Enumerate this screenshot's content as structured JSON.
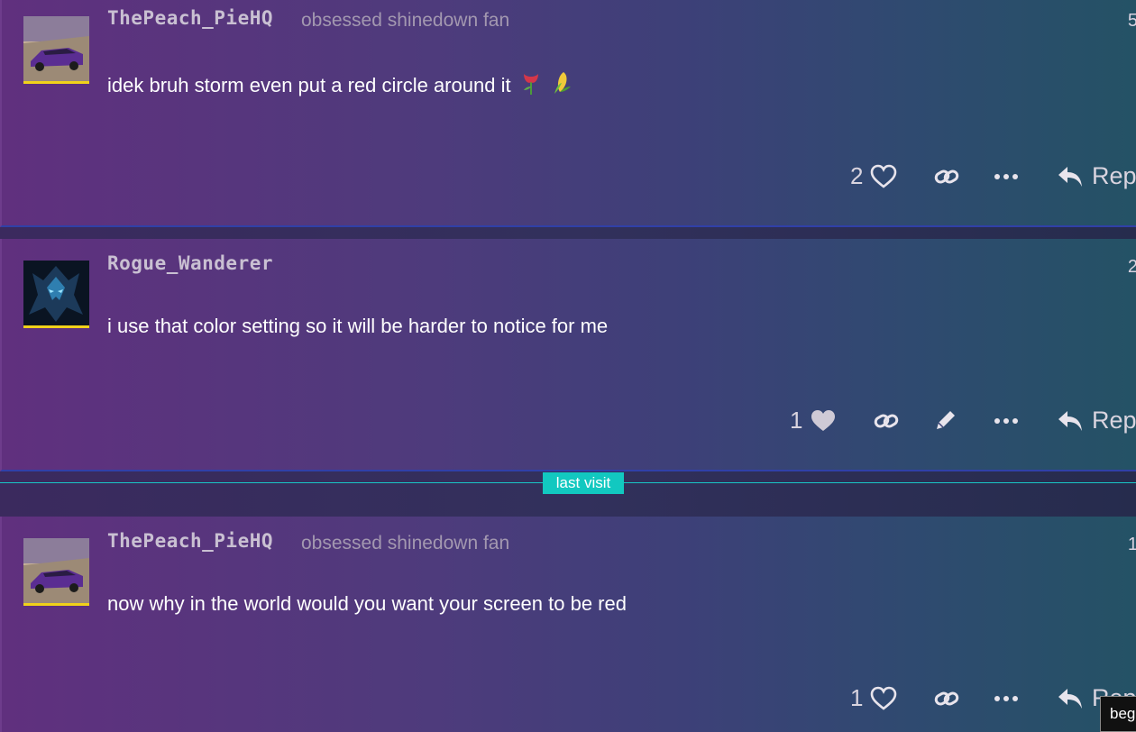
{
  "posts": [
    {
      "username": "ThePeach_PieHQ",
      "user_title": "obsessed shinedown fan",
      "post_number": "5",
      "content": "idek bruh storm even put a red circle around it",
      "emojis": [
        "wilted-flower-emoji",
        "corn-emoji"
      ],
      "likes": "2",
      "liked": false,
      "avatar": "purple-muscle-car-avatar",
      "actions": [
        "like",
        "copy-link",
        "more",
        "reply"
      ],
      "reply_label": "Reply"
    },
    {
      "username": "Rogue_Wanderer",
      "user_title": "",
      "post_number": "2",
      "content": "i use that color setting so it will be harder to notice for me",
      "likes": "1",
      "liked": true,
      "avatar": "dark-blue-knight-avatar",
      "actions": [
        "like",
        "copy-link",
        "edit",
        "more",
        "reply"
      ],
      "reply_label": "Reply"
    },
    {
      "username": "ThePeach_PieHQ",
      "user_title": "obsessed shinedown fan",
      "post_number": "1",
      "content": "now why in the world would you want your screen to be red",
      "likes": "1",
      "liked": false,
      "avatar": "purple-muscle-car-avatar",
      "actions": [
        "like",
        "copy-link",
        "more",
        "reply"
      ],
      "reply_label": "Reply"
    }
  ],
  "last_visit_label": "last visit",
  "tooltip_text": "beg",
  "colors": {
    "accent_cyan": "#12c8c0",
    "avatar_flair": "#f1d21a",
    "post_divider": "#3040a8"
  }
}
